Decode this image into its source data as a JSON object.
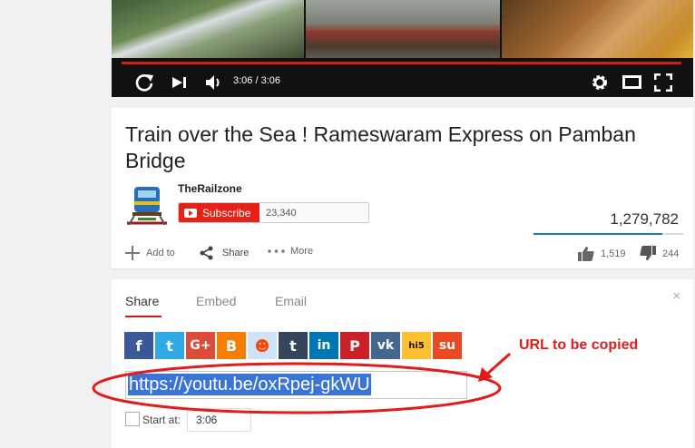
{
  "player": {
    "time_display": "3:06 / 3:06",
    "icons": [
      "replay-icon",
      "next-icon",
      "volume-icon",
      "settings-icon",
      "theater-mode-icon",
      "fullscreen-icon"
    ],
    "progress_fraction": 1.0,
    "progress_color": "#d41c1c"
  },
  "video": {
    "title": "Train over the Sea ! Rameswaram Express on Pamban Bridge",
    "channel_name": "TheRailzone",
    "subscribe_label": "Subscribe",
    "subscriber_count": "23,340",
    "view_count": "1,279,782",
    "like_fraction": 0.862,
    "actions": {
      "add_to": "Add to",
      "share": "Share",
      "more": "More"
    },
    "likes": "1,519",
    "dislikes": "244",
    "accent_color": "#e62117",
    "bar_color": "#167ac6"
  },
  "share_panel": {
    "tabs": [
      "Share",
      "Embed",
      "Email"
    ],
    "active_tab": "Share",
    "close_glyph": "×",
    "social": [
      {
        "name": "facebook",
        "glyph": "f",
        "color": "#3b5998"
      },
      {
        "name": "twitter",
        "glyph": "t",
        "color": "#2fa8e6"
      },
      {
        "name": "google-plus",
        "glyph": "G+",
        "color": "#dd4b39"
      },
      {
        "name": "blogger",
        "glyph": "B",
        "color": "#f57d00"
      },
      {
        "name": "reddit",
        "glyph": "☻",
        "color": "#cee3f8"
      },
      {
        "name": "tumblr",
        "glyph": "t",
        "color": "#35465c"
      },
      {
        "name": "linkedin",
        "glyph": "in",
        "color": "#0077b5"
      },
      {
        "name": "pinterest",
        "glyph": "P",
        "color": "#cb2027"
      },
      {
        "name": "vk",
        "glyph": "vk",
        "color": "#45668e"
      },
      {
        "name": "hi5",
        "glyph": "hi5",
        "color": "#fec02e"
      },
      {
        "name": "stumbleupon",
        "glyph": "su",
        "color": "#eb4924"
      }
    ],
    "url": "https://youtu.be/oxRpej-gkWU",
    "start_at_label": "Start at:",
    "start_at_value": "3:06"
  },
  "annotation": {
    "text": "URL to be copied",
    "color": "#e21b1b"
  }
}
